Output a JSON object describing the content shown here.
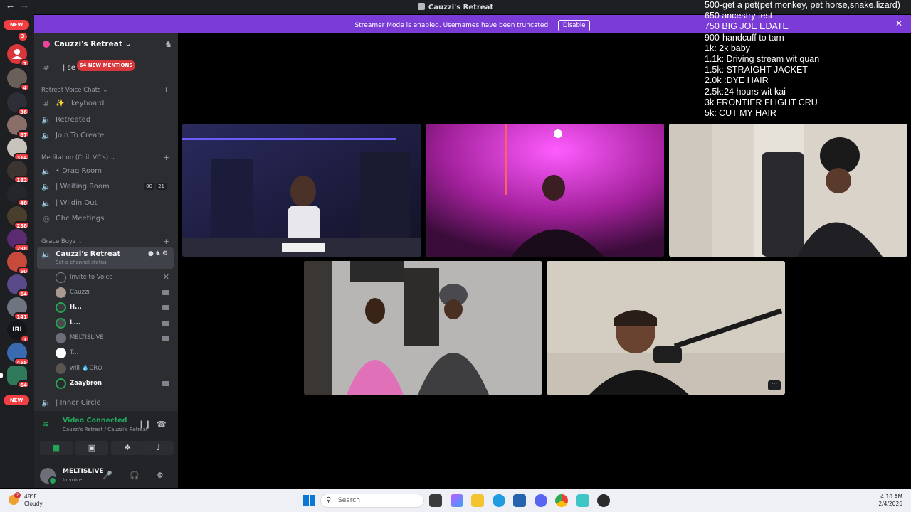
{
  "window": {
    "title": "Cauzzi's Retreat",
    "nav_back": "←",
    "nav_fwd": "→"
  },
  "banner": {
    "text": "Streamer Mode is enabled. Usernames have been truncated.",
    "button": "Disable",
    "close": "✕"
  },
  "server_rail": [
    {
      "label": "NEW"
    },
    {
      "badge": "3"
    },
    {
      "badge": "1"
    },
    {
      "badge": "4"
    },
    {
      "badge": "36"
    },
    {
      "badge": "67"
    },
    {
      "badge": "314"
    },
    {
      "badge": "182"
    },
    {
      "badge": "48"
    },
    {
      "badge": "238"
    },
    {
      "badge": "298"
    },
    {
      "badge": "50"
    },
    {
      "badge": "64"
    },
    {
      "badge": "141"
    },
    {
      "badge": "1"
    },
    {
      "badge": "455"
    },
    {
      "badge": "64"
    },
    {
      "label": "NEW"
    }
  ],
  "server": {
    "name": "Cauzzi's Retreat",
    "mentions": "64 NEW MENTIONS",
    "top_channel_prefix": "| se"
  },
  "categories": {
    "retreat_voice": "Retreat Voice Chats",
    "meditation": "Meditation (Chill VC's)",
    "grace": "Grace Boyz"
  },
  "channels": {
    "keyboard": "✨ · keyboard",
    "retreated": "Retreated",
    "join_to_create": "Join To Create",
    "drag_room": "• Drag Room",
    "waiting_room": "| Waiting Room",
    "waiting_room_counts": [
      "00",
      "21"
    ],
    "wildin_out": "| Wildin Out",
    "gbc_meetings": "Gbc Meetings",
    "cauzzi_retreat": "Cauzzi's Retreat",
    "channel_status": "Set a channel status",
    "inner_circle": "| Inner Circle"
  },
  "members": [
    {
      "name": "Invite to Voice",
      "type": "invite"
    },
    {
      "name": "Cauzzi",
      "type": "cam"
    },
    {
      "name": "H...",
      "type": "cam",
      "bold": true
    },
    {
      "name": "L...",
      "type": "cam",
      "bold": true
    },
    {
      "name": "MELTISLIVE",
      "type": "cam"
    },
    {
      "name": "T...",
      "type": "none"
    },
    {
      "name": "will 💧CRO",
      "type": "none"
    },
    {
      "name": "Zaaybron",
      "type": "cam",
      "bold": true
    }
  ],
  "voice": {
    "status": "Video Connected",
    "location": "Cauzzi's Retreat / Cauzzi's Retreat"
  },
  "user": {
    "name": "MELTISLIVE",
    "status": "In voice"
  },
  "goals": [
    "500-get a pet(pet monkey, pet horse,snake,lizard)",
    "650 ancestry test",
    "750 BIG JOE EDATE",
    "900-handcuff to tarn",
    "1k: 2k baby",
    "1.1k: Driving stream wit quan",
    "1.5k: STRAIGHT JACKET",
    "2.0k :DYE HAIR",
    "2.5k:24 hours wit kai",
    "3k FRONTIER FLIGHT CRU",
    "5k: CUT MY HAIR"
  ],
  "tiles": {
    "more": "···"
  },
  "taskbar": {
    "temp": "48°F",
    "weather": "Cloudy",
    "weather_badge": "2",
    "search": "Search",
    "time": "4:10 AM",
    "date": "2/4/2026"
  }
}
